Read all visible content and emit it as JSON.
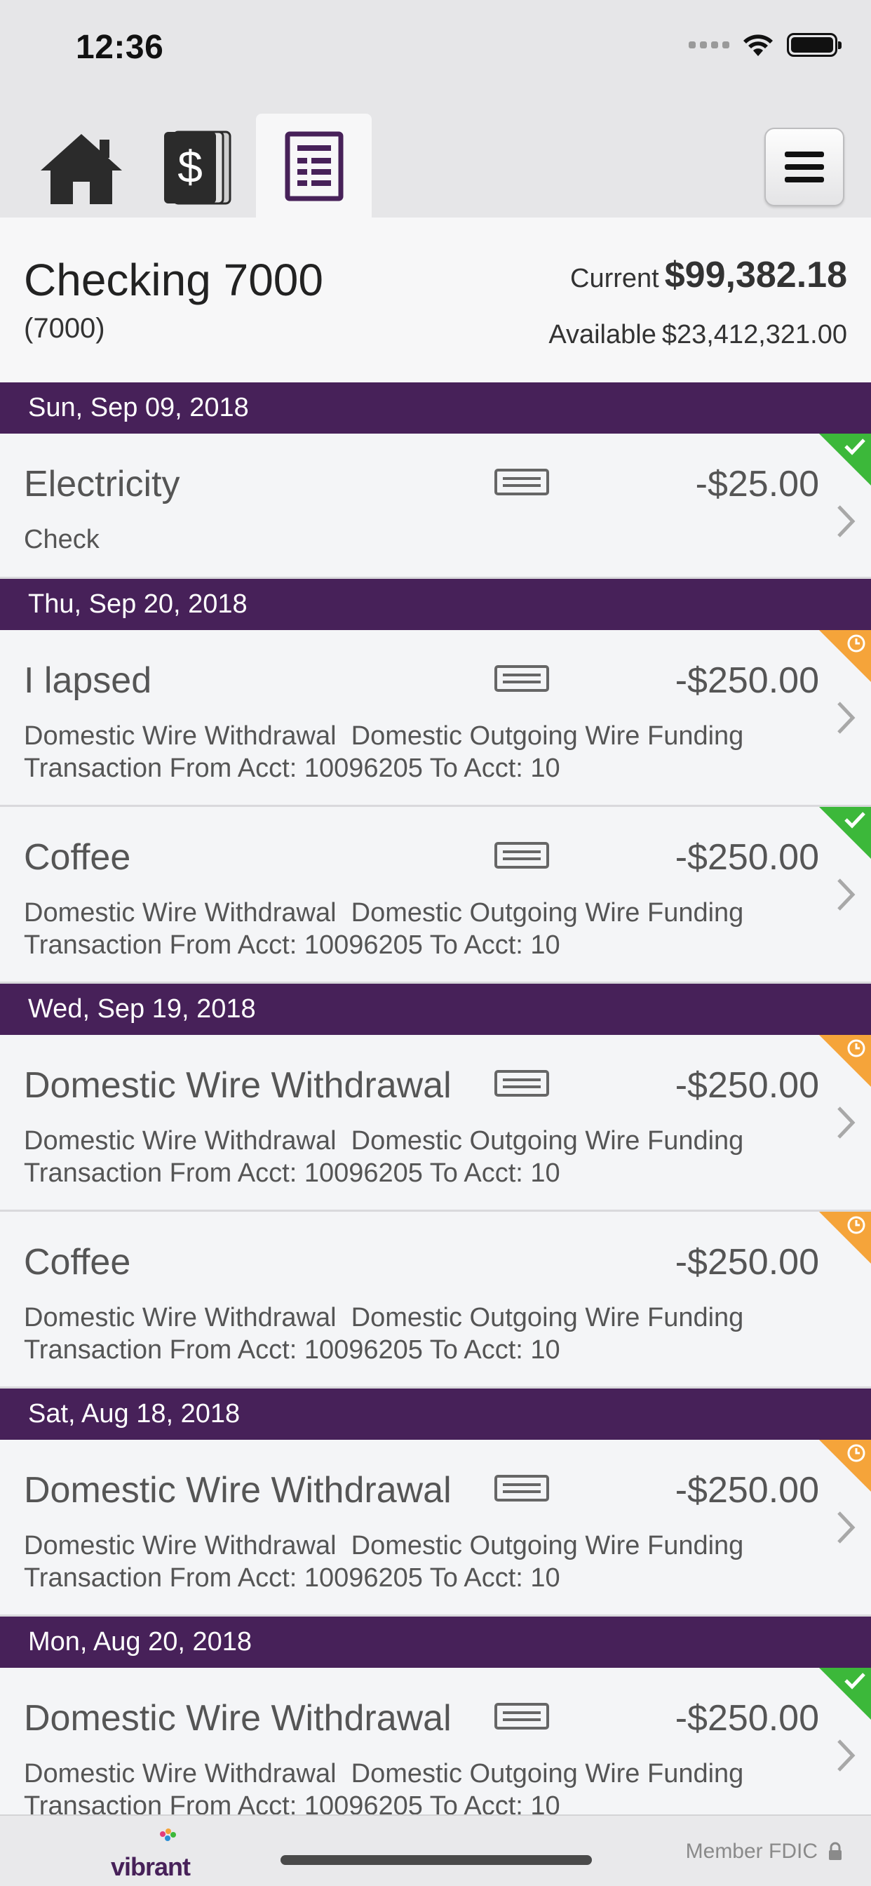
{
  "status_bar": {
    "time": "12:36"
  },
  "tabs": [
    {
      "name": "home",
      "icon": "home-icon"
    },
    {
      "name": "money",
      "icon": "dollar-stack-icon"
    },
    {
      "name": "statement",
      "icon": "statement-icon",
      "active": true
    }
  ],
  "menu": {
    "icon": "hamburger-menu-icon"
  },
  "account": {
    "name": "Checking 7000",
    "number": "(7000)",
    "current_label": "Current",
    "current_value": "$99,382.18",
    "available_label": "Available",
    "available_value": "$23,412,321.00"
  },
  "groups": [
    {
      "date": "Sun, Sep 09, 2018",
      "transactions": [
        {
          "title": "Electricity",
          "amount": "-$25.00",
          "desc": "Check",
          "memo_icon": true,
          "chevron": true,
          "status": "cleared"
        }
      ]
    },
    {
      "date": "Thu, Sep 20, 2018",
      "transactions": [
        {
          "title": "I lapsed",
          "amount": "-$250.00",
          "desc": "Domestic Wire Withdrawal  Domestic Outgoing Wire Funding\nTransaction From Acct: 10096205 To Acct: 10",
          "memo_icon": true,
          "chevron": true,
          "status": "pending"
        },
        {
          "title": "Coffee",
          "amount": "-$250.00",
          "desc": "Domestic Wire Withdrawal  Domestic Outgoing Wire Funding\nTransaction From Acct: 10096205 To Acct: 10",
          "memo_icon": true,
          "chevron": true,
          "status": "cleared"
        }
      ]
    },
    {
      "date": "Wed, Sep 19, 2018",
      "transactions": [
        {
          "title": "Domestic Wire Withdrawal",
          "amount": "-$250.00",
          "desc": "Domestic Wire Withdrawal  Domestic Outgoing Wire Funding\nTransaction From Acct: 10096205 To Acct: 10",
          "memo_icon": true,
          "chevron": true,
          "status": "pending"
        },
        {
          "title": "Coffee",
          "amount": "-$250.00",
          "desc": "Domestic Wire Withdrawal  Domestic Outgoing Wire Funding\nTransaction From Acct: 10096205 To Acct: 10",
          "memo_icon": false,
          "chevron": false,
          "status": "pending"
        }
      ]
    },
    {
      "date": "Sat, Aug 18, 2018",
      "transactions": [
        {
          "title": "Domestic Wire Withdrawal",
          "amount": "-$250.00",
          "desc": "Domestic Wire Withdrawal  Domestic Outgoing Wire Funding\nTransaction From Acct: 10096205 To Acct: 10",
          "memo_icon": true,
          "chevron": true,
          "status": "pending"
        }
      ]
    },
    {
      "date": "Mon, Aug 20, 2018",
      "transactions": [
        {
          "title": "Domestic Wire Withdrawal",
          "amount": "-$250.00",
          "desc": "Domestic Wire Withdrawal  Domestic Outgoing Wire Funding\nTransaction From Acct: 10096205 To Acct: 10",
          "memo_icon": true,
          "chevron": true,
          "status": "cleared"
        }
      ]
    }
  ],
  "footer": {
    "logo": "vibrant",
    "fdic": "Member FDIC",
    "lock_icon": "lock-icon"
  },
  "colors": {
    "header_purple": "#472159",
    "cleared_green": "#3cb83a",
    "pending_orange": "#f5a43a"
  }
}
